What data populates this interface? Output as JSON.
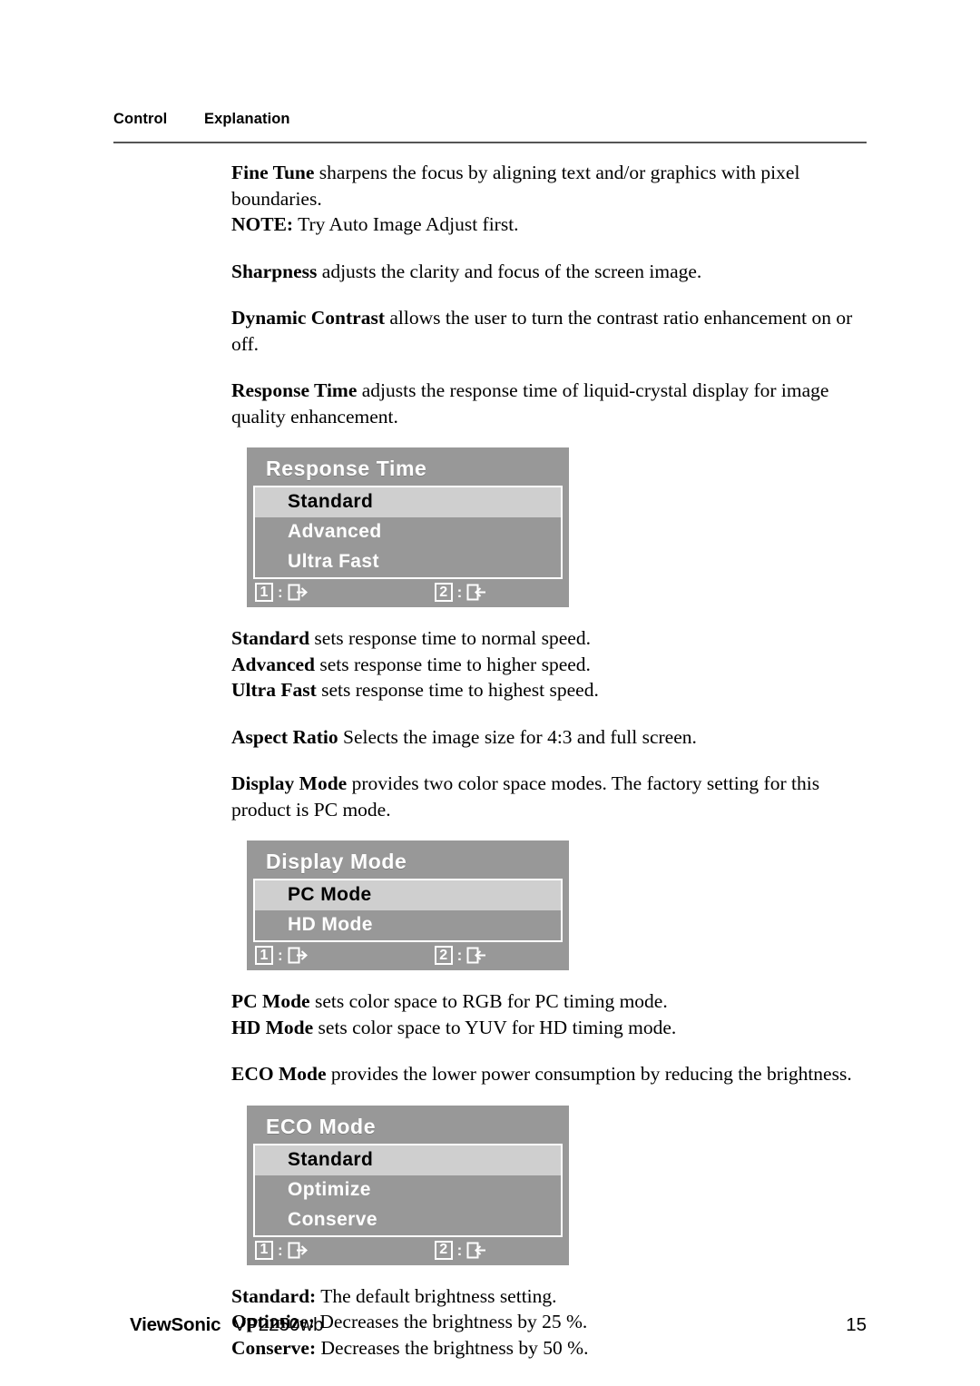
{
  "header": {
    "col1": "Control",
    "col2": "Explanation"
  },
  "body": {
    "fine_tune": {
      "term": "Fine Tune",
      "text": " sharpens the focus by aligning text and/or graphics with pixel boundaries."
    },
    "fine_tune_note": {
      "term": "NOTE:",
      "text": " Try Auto Image Adjust first."
    },
    "sharpness": {
      "term": "Sharpness",
      "text": " adjusts the clarity and focus of the screen image."
    },
    "dynamic_contrast": {
      "term": "Dynamic Contrast",
      "text": " allows the user to turn the contrast ratio enhancement on or off."
    },
    "response_time": {
      "term": "Response Time",
      "text": " adjusts the response time of liquid-crystal display for image quality enhancement."
    },
    "response_standard": {
      "term": "Standard",
      "text": " sets response time to normal speed."
    },
    "response_advanced": {
      "term": "Advanced",
      "text": " sets response time to higher speed."
    },
    "response_ultrafast": {
      "term": "Ultra Fast",
      "text": " sets response time to highest speed."
    },
    "aspect_ratio": {
      "term": "Aspect Ratio",
      "text": " Selects the image size for 4:3 and full screen."
    },
    "display_mode": {
      "term": "Display Mode",
      "text": " provides two color space modes. The factory setting for this product is PC mode."
    },
    "pc_mode": {
      "term": "PC Mode",
      "text": " sets color space to RGB for PC timing mode."
    },
    "hd_mode": {
      "term": "HD Mode",
      "text": " sets color space to YUV for HD timing mode."
    },
    "eco_mode": {
      "term": "ECO Mode",
      "text": " provides the lower power consumption by reducing the brightness."
    },
    "eco_standard": {
      "term": "Standard:",
      "text": " The default brightness setting."
    },
    "eco_optimize": {
      "term": "Optimize:",
      "text": " Decreases the brightness by 25 %."
    },
    "eco_conserve": {
      "term": "Conserve:",
      "text": " Decreases the brightness by 50 %."
    }
  },
  "osd_menus": {
    "response_time": {
      "title": "Response Time",
      "items": [
        {
          "label": "Standard",
          "selected": true
        },
        {
          "label": "Advanced",
          "selected": false
        },
        {
          "label": "Ultra Fast",
          "selected": false
        }
      ],
      "keys": [
        {
          "number": "1",
          "separator": ":",
          "icon": "exit-icon"
        },
        {
          "number": "2",
          "separator": ":",
          "icon": "return-icon"
        }
      ]
    },
    "display_mode": {
      "title": "Display Mode",
      "items": [
        {
          "label": "PC Mode",
          "selected": true
        },
        {
          "label": "HD Mode",
          "selected": false
        }
      ],
      "keys": [
        {
          "number": "1",
          "separator": ":",
          "icon": "exit-icon"
        },
        {
          "number": "2",
          "separator": ":",
          "icon": "return-icon"
        }
      ]
    },
    "eco_mode": {
      "title": "ECO Mode",
      "items": [
        {
          "label": "Standard",
          "selected": true
        },
        {
          "label": "Optimize",
          "selected": false
        },
        {
          "label": "Conserve",
          "selected": false
        }
      ],
      "keys": [
        {
          "number": "1",
          "separator": ":",
          "icon": "exit-icon"
        },
        {
          "number": "2",
          "separator": ":",
          "icon": "return-icon"
        }
      ]
    }
  },
  "footer": {
    "brand": "ViewSonic",
    "model": "VP2250wb",
    "page_number": "15"
  },
  "colors": {
    "osd_panel": "#989898",
    "osd_selected": "#cfcfcf",
    "osd_border": "#ffffff",
    "rule": "#555555"
  }
}
